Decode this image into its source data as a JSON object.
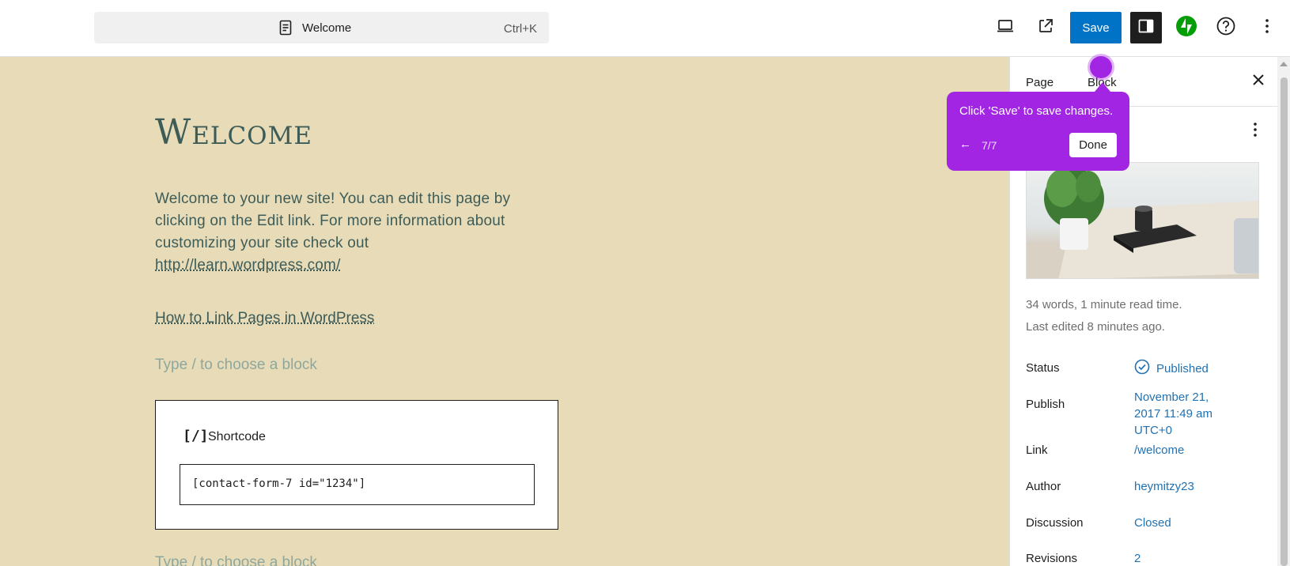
{
  "toolbar": {
    "doc_title": "Welcome",
    "shortcut": "Ctrl+K",
    "save_label": "Save"
  },
  "editor": {
    "page_title": "Welcome",
    "paragraph_text": "Welcome to your new site! You can edit this page by clicking on the Edit link. For more information about customizing your site check out ",
    "paragraph_link": "http://learn.wordpress.com/",
    "link_text": "How to Link Pages in WordPress",
    "placeholder": "Type / to choose a block",
    "shortcode": {
      "icon_text": "[/]",
      "label": "Shortcode",
      "value": "[contact-form-7 id=\"1234\"]"
    }
  },
  "sidebar": {
    "tabs": [
      "Page",
      "Block"
    ],
    "stats": "34 words, 1 minute read time.",
    "last_edited": "Last edited 8 minutes ago.",
    "rows": [
      {
        "label": "Status",
        "value": "Published"
      },
      {
        "label": "Publish",
        "value": "November 21, 2017 11:49 am UTC+0"
      },
      {
        "label": "Link",
        "value": "/welcome"
      },
      {
        "label": "Author",
        "value": "heymitzy23"
      },
      {
        "label": "Discussion",
        "value": "Closed"
      },
      {
        "label": "Revisions",
        "value": "2"
      }
    ]
  },
  "tour": {
    "text": "Click 'Save' to save changes.",
    "back_glyph": "←",
    "step": "7/7",
    "done_label": "Done"
  },
  "colors": {
    "accent": "#0073c6",
    "tour": "#a225e3",
    "canvas_bg": "#e8dcb8",
    "heading": "#3d5c58",
    "link": "#2271b1",
    "jetpack": "#069e08"
  },
  "icons": [
    "document-icon",
    "desktop-preview-icon",
    "external-link-icon",
    "sidebar-settings-icon",
    "jetpack-icon",
    "help-icon",
    "more-vertical-icon",
    "close-icon",
    "published-check-icon",
    "arrow-left-icon",
    "shortcode-icon"
  ]
}
